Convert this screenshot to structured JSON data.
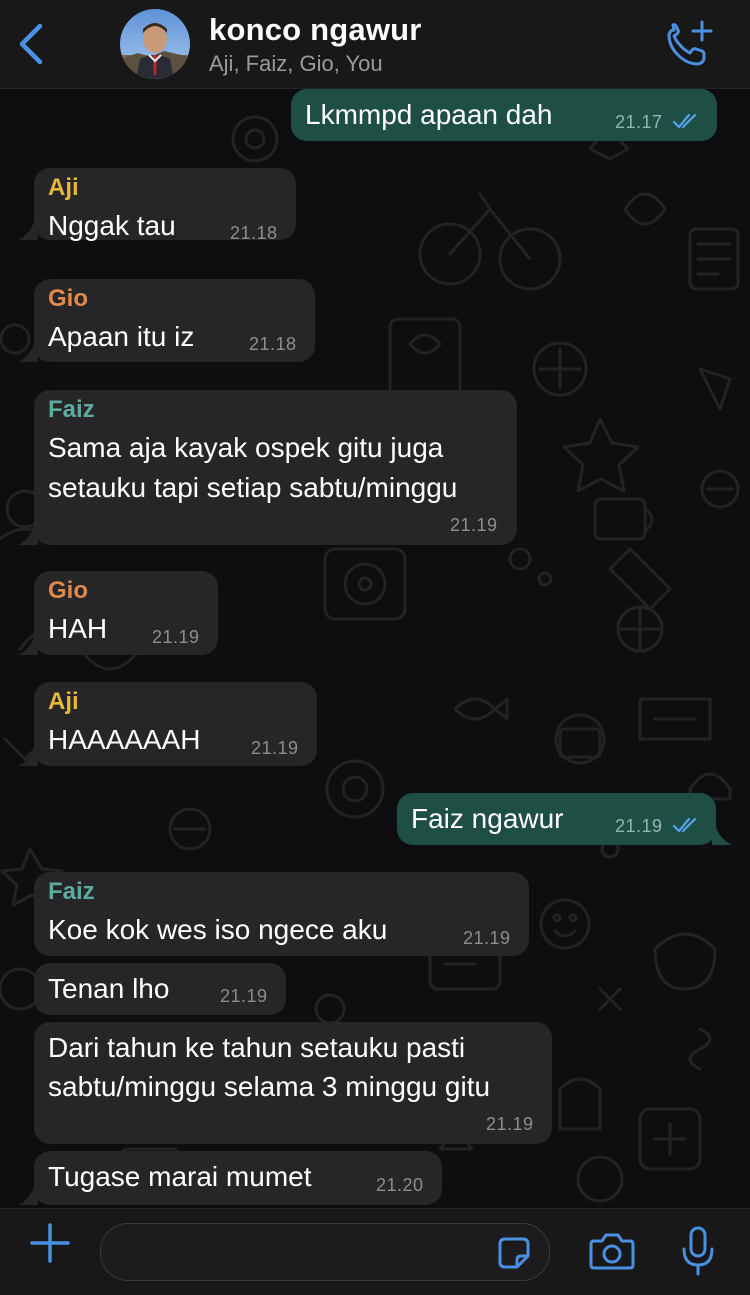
{
  "header": {
    "title": "konco ngawur",
    "subtitle": "Aji, Faiz, Gio, You",
    "back_icon": "chevron-left-icon",
    "call_icon": "add-call-icon",
    "accent_color": "#4a90e2"
  },
  "messages": [
    {
      "id": "m1",
      "direction": "out",
      "text": "Lkmmpd apaan dah",
      "time": "21.17",
      "status": "read"
    },
    {
      "id": "m2",
      "direction": "in",
      "sender": "Aji",
      "text": "Nggak tau",
      "time": "21.18"
    },
    {
      "id": "m3",
      "direction": "in",
      "sender": "Gio",
      "text": "Apaan itu iz",
      "time": "21.18"
    },
    {
      "id": "m4",
      "direction": "in",
      "sender": "Faiz",
      "lines": [
        "Sama aja kayak ospek gitu juga",
        "setauku tapi setiap sabtu/minggu"
      ],
      "time": "21.19"
    },
    {
      "id": "m5",
      "direction": "in",
      "sender": "Gio",
      "text": "HAH",
      "time": "21.19"
    },
    {
      "id": "m6",
      "direction": "in",
      "sender": "Aji",
      "text": "HAAAAAAH",
      "time": "21.19"
    },
    {
      "id": "m7",
      "direction": "out",
      "text": "Faiz ngawur",
      "time": "21.19",
      "status": "read"
    },
    {
      "id": "m8",
      "direction": "in",
      "sender": "Faiz",
      "text": "Koe kok wes iso ngece aku",
      "time": "21.19"
    },
    {
      "id": "m9",
      "direction": "in",
      "text": "Tenan lho",
      "time": "21.19"
    },
    {
      "id": "m10",
      "direction": "in",
      "lines": [
        "Dari tahun ke tahun setauku pasti",
        "sabtu/minggu selama 3 minggu gitu"
      ],
      "time": "21.19"
    },
    {
      "id": "m11",
      "direction": "in",
      "text": "Tugase marai mumet",
      "time": "21.20"
    }
  ],
  "sender_colors": {
    "Aji": "#e5b73b",
    "Gio": "#e2884a",
    "Faiz": "#5cab9f"
  },
  "input": {
    "placeholder": "",
    "value": "",
    "icons": [
      "plus-icon",
      "sticker-icon",
      "camera-icon",
      "microphone-icon"
    ]
  }
}
